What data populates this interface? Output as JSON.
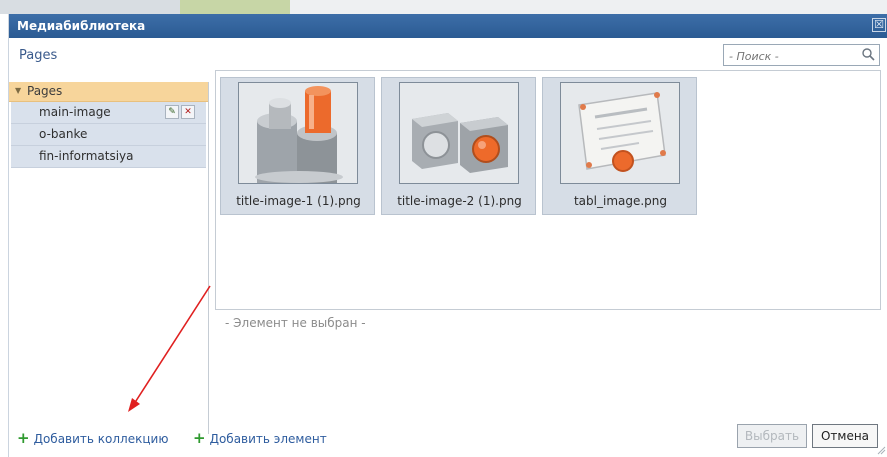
{
  "window": {
    "title": "Медиабиблиотека",
    "close_glyph": "☒"
  },
  "header": {
    "breadcrumb": "Pages",
    "search_placeholder": "- Поиск -"
  },
  "tree": {
    "root": {
      "arrow": "▼",
      "label": "Pages"
    },
    "items": [
      {
        "label": "main-image",
        "edit_glyph": "✎",
        "delete_glyph": "✕"
      },
      {
        "label": "o-banke"
      },
      {
        "label": "fin-informatsiya"
      }
    ]
  },
  "gallery": {
    "items": [
      {
        "name": "title-image-1 (1).png",
        "icon": "cylinders-image"
      },
      {
        "name": "title-image-2 (1).png",
        "icon": "cubes-image"
      },
      {
        "name": "tabl_image.png",
        "icon": "certificate-image"
      }
    ]
  },
  "status": "- Элемент не выбран -",
  "footer": {
    "add_collection": "Добавить коллекцию",
    "add_element": "Добавить элемент",
    "choose": "Выбрать",
    "cancel": "Отмена",
    "plus_glyph": "+"
  },
  "colors": {
    "titlebar": "#2b5b93",
    "tree_selected": "#f7d59b",
    "tree_item": "#d9e1ec",
    "link": "#2e5c9e",
    "annotation_arrow": "#e02020"
  }
}
